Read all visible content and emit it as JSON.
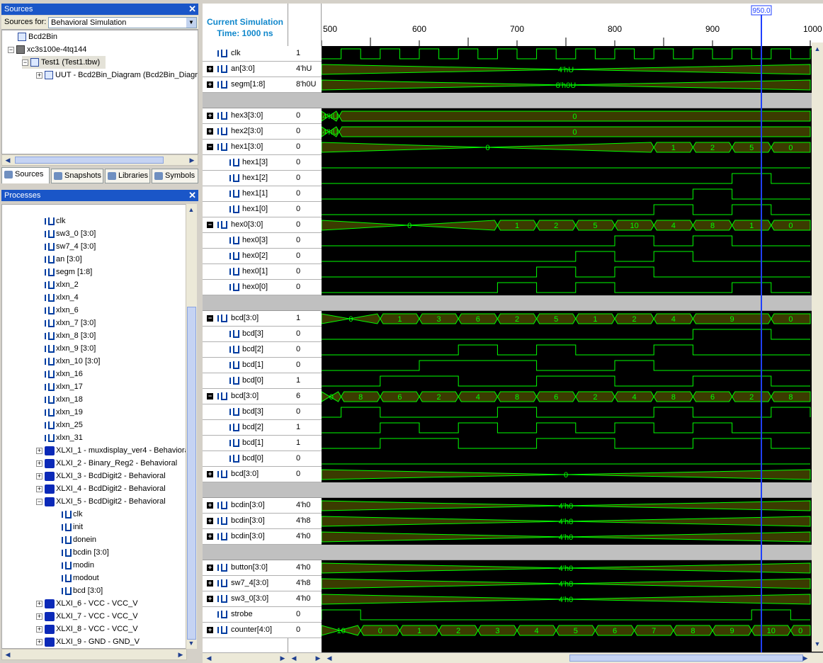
{
  "sources_panel": {
    "title": "Sources",
    "sources_for_label": "Sources for:",
    "sources_for_value": "Behavioral Simulation",
    "tree": [
      "Bcd2Bin",
      "xc3s100e-4tq144",
      "Test1 (Test1.tbw)",
      "UUT - Bcd2Bin_Diagram (Bcd2Bin_Diagr"
    ],
    "tabs": [
      "Sources",
      "Snapshots",
      "Libraries",
      "Symbols"
    ]
  },
  "processes_panel": {
    "title": "Processes",
    "items": [
      {
        "label": "clk",
        "kind": "sig"
      },
      {
        "label": "sw3_0 [3:0]",
        "kind": "bus"
      },
      {
        "label": "sw7_4 [3:0]",
        "kind": "bus"
      },
      {
        "label": "an [3:0]",
        "kind": "bus"
      },
      {
        "label": "segm [1:8]",
        "kind": "bus"
      },
      {
        "label": "xlxn_2",
        "kind": "sig"
      },
      {
        "label": "xlxn_4",
        "kind": "sig"
      },
      {
        "label": "xlxn_6",
        "kind": "sig"
      },
      {
        "label": "xlxn_7 [3:0]",
        "kind": "bus"
      },
      {
        "label": "xlxn_8 [3:0]",
        "kind": "bus"
      },
      {
        "label": "xlxn_9 [3:0]",
        "kind": "bus"
      },
      {
        "label": "xlxn_10 [3:0]",
        "kind": "bus"
      },
      {
        "label": "xlxn_16",
        "kind": "sig"
      },
      {
        "label": "xlxn_17",
        "kind": "sig"
      },
      {
        "label": "xlxn_18",
        "kind": "sig"
      },
      {
        "label": "xlxn_19",
        "kind": "sig"
      },
      {
        "label": "xlxn_25",
        "kind": "sig"
      },
      {
        "label": "xlxn_31",
        "kind": "sig"
      },
      {
        "label": "XLXI_1 - muxdisplay_ver4 - Behavioral",
        "kind": "blk",
        "exp": "+"
      },
      {
        "label": "XLXI_2 - Binary_Reg2 - Behavioral",
        "kind": "blk",
        "exp": "+"
      },
      {
        "label": "XLXI_3 - BcdDigit2 - Behavioral",
        "kind": "blk",
        "exp": "+"
      },
      {
        "label": "XLXI_4 - BcdDigit2 - Behavioral",
        "kind": "blk",
        "exp": "+"
      },
      {
        "label": "XLXI_5 - BcdDigit2 - Behavioral",
        "kind": "blk",
        "exp": "-"
      },
      {
        "label": "clk",
        "kind": "sig",
        "sub": true
      },
      {
        "label": "init",
        "kind": "sig",
        "sub": true
      },
      {
        "label": "donein",
        "kind": "sig",
        "sub": true
      },
      {
        "label": "bcdin [3:0]",
        "kind": "bus",
        "sub": true
      },
      {
        "label": "modin",
        "kind": "sig",
        "sub": true
      },
      {
        "label": "modout",
        "kind": "sig",
        "sub": true
      },
      {
        "label": "bcd [3:0]",
        "kind": "bus",
        "sub": true
      },
      {
        "label": "XLXI_6 - VCC - VCC_V",
        "kind": "blk",
        "exp": "+"
      },
      {
        "label": "XLXI_7 - VCC - VCC_V",
        "kind": "blk",
        "exp": "+"
      },
      {
        "label": "XLXI_8 - VCC - VCC_V",
        "kind": "blk",
        "exp": "+"
      },
      {
        "label": "XLXI_9 - GND - GND_V",
        "kind": "blk",
        "exp": "+"
      }
    ]
  },
  "waveform": {
    "header_title": "Current Simulation Time: 1000 ns",
    "cursor_label": "950.0",
    "time_ticks": [
      "500",
      "600",
      "700",
      "800",
      "900",
      "1000"
    ],
    "colors": {
      "wave": "#00ff00",
      "bus_fill": "#3b3b00",
      "cursor": "#2040ff",
      "bg": "#000000"
    },
    "rows": [
      {
        "name": "clk",
        "value": "1",
        "type": "clk"
      },
      {
        "name": "an[3:0]",
        "value": "4'hU",
        "type": "bus",
        "pm": "+",
        "segs": [
          [
            "4'hU",
            500,
            1000
          ]
        ]
      },
      {
        "name": "segm[1:8]",
        "value": "8'h0U",
        "type": "bus",
        "pm": "+",
        "segs": [
          [
            "8'h0U",
            500,
            1000
          ]
        ]
      },
      {
        "type": "sep"
      },
      {
        "name": "hex3[3:0]",
        "value": "0",
        "type": "bus",
        "pm": "+",
        "segs": [
          [
            "4'hU",
            500,
            518
          ],
          [
            "0",
            518,
            1000
          ]
        ]
      },
      {
        "name": "hex2[3:0]",
        "value": "0",
        "type": "bus",
        "pm": "+",
        "segs": [
          [
            "4'hU",
            500,
            518
          ],
          [
            "0",
            518,
            1000
          ]
        ]
      },
      {
        "name": "hex1[3:0]",
        "value": "0",
        "type": "bus",
        "pm": "-",
        "segs": [
          [
            "0",
            500,
            840
          ],
          [
            "1",
            840,
            880
          ],
          [
            "2",
            880,
            920
          ],
          [
            "5",
            920,
            960
          ],
          [
            "0",
            960,
            1000
          ]
        ]
      },
      {
        "name": "hex1[3]",
        "value": "0",
        "type": "bit",
        "sub": true,
        "hi": []
      },
      {
        "name": "hex1[2]",
        "value": "0",
        "type": "bit",
        "sub": true,
        "hi": [
          [
            920,
            960
          ]
        ]
      },
      {
        "name": "hex1[1]",
        "value": "0",
        "type": "bit",
        "sub": true,
        "hi": [
          [
            880,
            920
          ]
        ]
      },
      {
        "name": "hex1[0]",
        "value": "0",
        "type": "bit",
        "sub": true,
        "hi": [
          [
            840,
            880
          ],
          [
            920,
            960
          ]
        ]
      },
      {
        "name": "hex0[3:0]",
        "value": "0",
        "type": "bus",
        "pm": "-",
        "segs": [
          [
            "0",
            500,
            680
          ],
          [
            "1",
            680,
            720
          ],
          [
            "2",
            720,
            760
          ],
          [
            "5",
            760,
            800
          ],
          [
            "10",
            800,
            840
          ],
          [
            "4",
            840,
            880
          ],
          [
            "8",
            880,
            920
          ],
          [
            "1",
            920,
            960
          ],
          [
            "0",
            960,
            1000
          ]
        ]
      },
      {
        "name": "hex0[3]",
        "value": "0",
        "type": "bit",
        "sub": true,
        "hi": [
          [
            800,
            840
          ],
          [
            880,
            920
          ]
        ]
      },
      {
        "name": "hex0[2]",
        "value": "0",
        "type": "bit",
        "sub": true,
        "hi": [
          [
            760,
            800
          ],
          [
            840,
            880
          ]
        ]
      },
      {
        "name": "hex0[1]",
        "value": "0",
        "type": "bit",
        "sub": true,
        "hi": [
          [
            720,
            760
          ],
          [
            800,
            840
          ]
        ]
      },
      {
        "name": "hex0[0]",
        "value": "0",
        "type": "bit",
        "sub": true,
        "hi": [
          [
            680,
            720
          ],
          [
            760,
            800
          ],
          [
            920,
            960
          ]
        ]
      },
      {
        "type": "sep"
      },
      {
        "name": "bcd[3:0]",
        "value": "1",
        "type": "bus",
        "pm": "-",
        "segs": [
          [
            "0",
            500,
            560
          ],
          [
            "1",
            560,
            600
          ],
          [
            "3",
            600,
            640
          ],
          [
            "6",
            640,
            680
          ],
          [
            "2",
            680,
            720
          ],
          [
            "5",
            720,
            760
          ],
          [
            "1",
            760,
            800
          ],
          [
            "2",
            800,
            840
          ],
          [
            "4",
            840,
            880
          ],
          [
            "9",
            880,
            960
          ],
          [
            "0",
            960,
            1000
          ]
        ]
      },
      {
        "name": "bcd[3]",
        "value": "0",
        "type": "bit",
        "sub": true,
        "hi": [
          [
            880,
            960
          ]
        ]
      },
      {
        "name": "bcd[2]",
        "value": "0",
        "type": "bit",
        "sub": true,
        "hi": [
          [
            640,
            680
          ],
          [
            720,
            760
          ],
          [
            840,
            880
          ]
        ]
      },
      {
        "name": "bcd[1]",
        "value": "0",
        "type": "bit",
        "sub": true,
        "hi": [
          [
            600,
            720
          ],
          [
            800,
            840
          ]
        ]
      },
      {
        "name": "bcd[0]",
        "value": "1",
        "type": "bit",
        "sub": true,
        "hi": [
          [
            560,
            640
          ],
          [
            720,
            800
          ],
          [
            880,
            960
          ]
        ]
      },
      {
        "name": "bcd[3:0]",
        "value": "6",
        "type": "bus",
        "pm": "-",
        "segs": [
          [
            "0",
            500,
            520
          ],
          [
            "8",
            520,
            560
          ],
          [
            "6",
            560,
            600
          ],
          [
            "2",
            600,
            640
          ],
          [
            "4",
            640,
            680
          ],
          [
            "8",
            680,
            720
          ],
          [
            "6",
            720,
            760
          ],
          [
            "2",
            760,
            800
          ],
          [
            "4",
            800,
            840
          ],
          [
            "8",
            840,
            880
          ],
          [
            "6",
            880,
            920
          ],
          [
            "2",
            920,
            960
          ],
          [
            "8",
            960,
            1000
          ]
        ]
      },
      {
        "name": "bcd[3]",
        "value": "0",
        "type": "bit",
        "sub": true,
        "hi": [
          [
            520,
            560
          ],
          [
            680,
            720
          ],
          [
            840,
            880
          ],
          [
            960,
            1000
          ]
        ]
      },
      {
        "name": "bcd[2]",
        "value": "1",
        "type": "bit",
        "sub": true,
        "hi": [
          [
            560,
            600
          ],
          [
            640,
            680
          ],
          [
            720,
            760
          ],
          [
            800,
            840
          ],
          [
            880,
            920
          ]
        ]
      },
      {
        "name": "bcd[1]",
        "value": "1",
        "type": "bit",
        "sub": true,
        "hi": [
          [
            560,
            640
          ],
          [
            720,
            800
          ],
          [
            880,
            960
          ]
        ]
      },
      {
        "name": "bcd[0]",
        "value": "0",
        "type": "bit",
        "sub": true,
        "hi": []
      },
      {
        "name": "bcd[3:0]",
        "value": "0",
        "type": "bus",
        "pm": "+",
        "segs": [
          [
            "0",
            500,
            1000
          ]
        ]
      },
      {
        "type": "sep"
      },
      {
        "name": "bcdin[3:0]",
        "value": "4'h0",
        "type": "bus",
        "pm": "+",
        "segs": [
          [
            "4'h0",
            500,
            1000
          ]
        ]
      },
      {
        "name": "bcdin[3:0]",
        "value": "4'h8",
        "type": "bus",
        "pm": "+",
        "segs": [
          [
            "4'h8",
            500,
            1000
          ]
        ]
      },
      {
        "name": "bcdin[3:0]",
        "value": "4'h0",
        "type": "bus",
        "pm": "+",
        "segs": [
          [
            "4'h0",
            500,
            1000
          ]
        ]
      },
      {
        "type": "sep"
      },
      {
        "name": "button[3:0]",
        "value": "4'h0",
        "type": "bus",
        "pm": "+",
        "segs": [
          [
            "4'h0",
            500,
            1000
          ]
        ]
      },
      {
        "name": "sw7_4[3:0]",
        "value": "4'h8",
        "type": "bus",
        "pm": "+",
        "segs": [
          [
            "4'h8",
            500,
            1000
          ]
        ]
      },
      {
        "name": "sw3_0[3:0]",
        "value": "4'h0",
        "type": "bus",
        "pm": "+",
        "segs": [
          [
            "4'h0",
            500,
            1000
          ]
        ]
      },
      {
        "name": "strobe",
        "value": "0",
        "type": "bit",
        "hi": [
          [
            500,
            540
          ],
          [
            940,
            980
          ]
        ]
      },
      {
        "name": "counter[4:0]",
        "value": "0",
        "type": "bus",
        "pm": "+",
        "segs": [
          [
            "10",
            500,
            540
          ],
          [
            "0",
            540,
            580
          ],
          [
            "1",
            580,
            620
          ],
          [
            "2",
            620,
            660
          ],
          [
            "3",
            660,
            700
          ],
          [
            "4",
            700,
            740
          ],
          [
            "5",
            740,
            780
          ],
          [
            "6",
            780,
            820
          ],
          [
            "7",
            820,
            860
          ],
          [
            "8",
            860,
            900
          ],
          [
            "9",
            900,
            940
          ],
          [
            "10",
            940,
            980
          ],
          [
            "0",
            980,
            1000
          ]
        ]
      }
    ]
  }
}
